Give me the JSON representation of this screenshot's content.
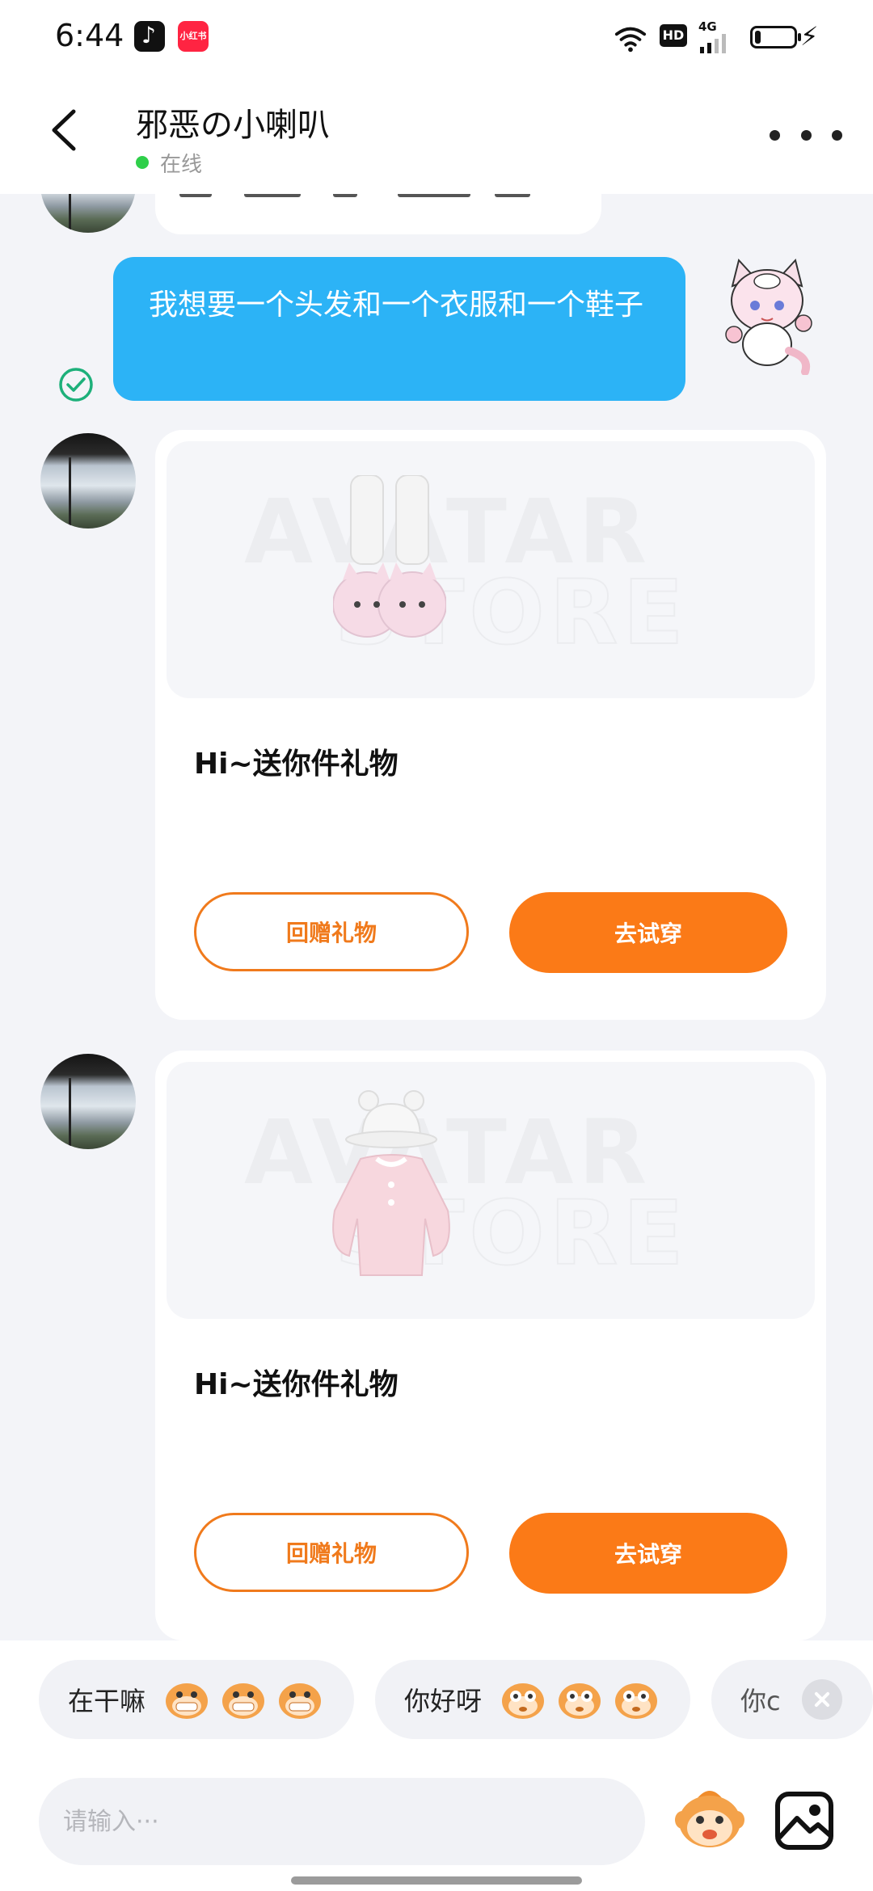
{
  "status_bar": {
    "time": "6:44",
    "network_label": "4G",
    "hd_label": "HD",
    "battery_level": 0.15,
    "apps": [
      "tiktok-icon",
      "xiaohongshu-icon"
    ]
  },
  "header": {
    "peer_name": "邪恶の小喇叭",
    "presence": "在线"
  },
  "messages": {
    "my_message": "我想要一个头发和一个衣服和一个鞋子",
    "gifts": [
      {
        "title": "Hi~送你件礼物",
        "return_label": "回赠礼物",
        "try_label": "去试穿",
        "item_icon": "cat-slipper-legwarmers-icon"
      },
      {
        "title": "Hi~送你件礼物",
        "return_label": "回赠礼物",
        "try_label": "去试穿",
        "item_icon": "pink-sweater-bucket-hat-icon"
      }
    ]
  },
  "quick_replies": [
    {
      "text": "在干嘛"
    },
    {
      "text": "你好呀"
    },
    {
      "text": "你c"
    }
  ],
  "input": {
    "placeholder": "请输入···"
  },
  "colors": {
    "accent_orange": "#fb7a17",
    "bubble_blue": "#2cb3f6",
    "online_green": "#2fcf4a"
  }
}
